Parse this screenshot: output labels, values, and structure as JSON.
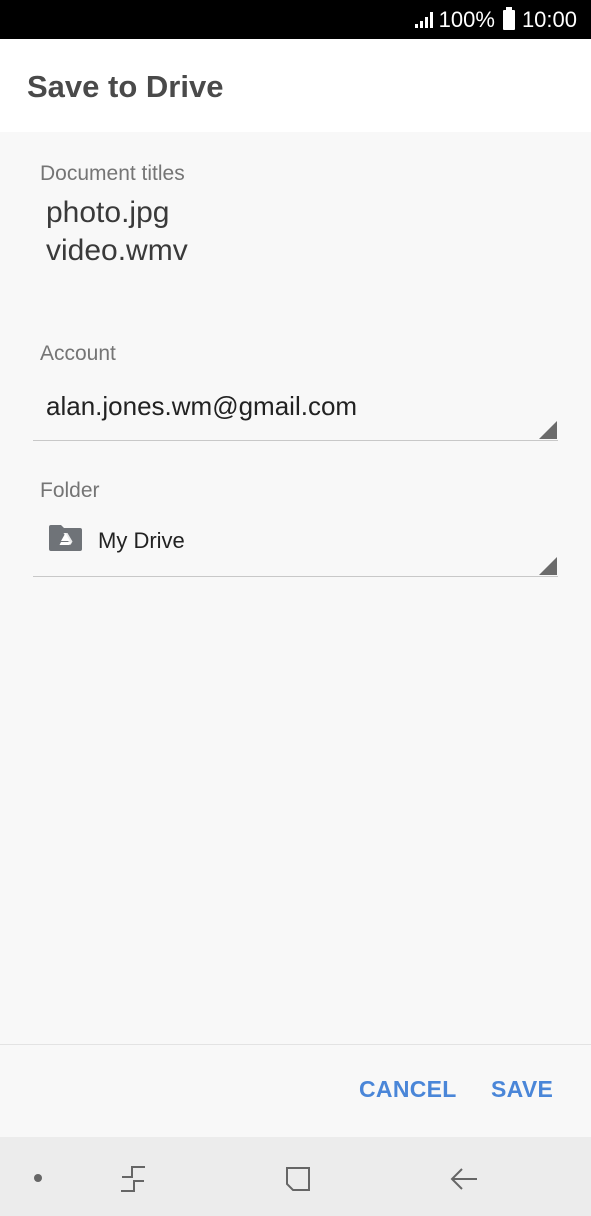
{
  "status_bar": {
    "battery_text": "100%",
    "time": "10:00"
  },
  "header": {
    "title": "Save to Drive"
  },
  "form": {
    "document_titles_label": "Document titles",
    "document_titles": [
      "photo.jpg",
      "video.wmv"
    ],
    "account_label": "Account",
    "account_value": "alan.jones.wm@gmail.com",
    "folder_label": "Folder",
    "folder_value": "My Drive"
  },
  "actions": {
    "cancel_label": "CANCEL",
    "save_label": "SAVE"
  },
  "colors": {
    "accent": "#4a86d8",
    "status_bar_bg": "#000000",
    "header_bg": "#ffffff",
    "body_bg": "#f8f8f8",
    "nav_bar_bg": "#ececec"
  },
  "icons": {
    "folder": "drive-folder-icon",
    "nav_dot": "dot-icon",
    "nav_recents": "recents-icon",
    "nav_home": "home-icon",
    "nav_back": "back-icon"
  }
}
